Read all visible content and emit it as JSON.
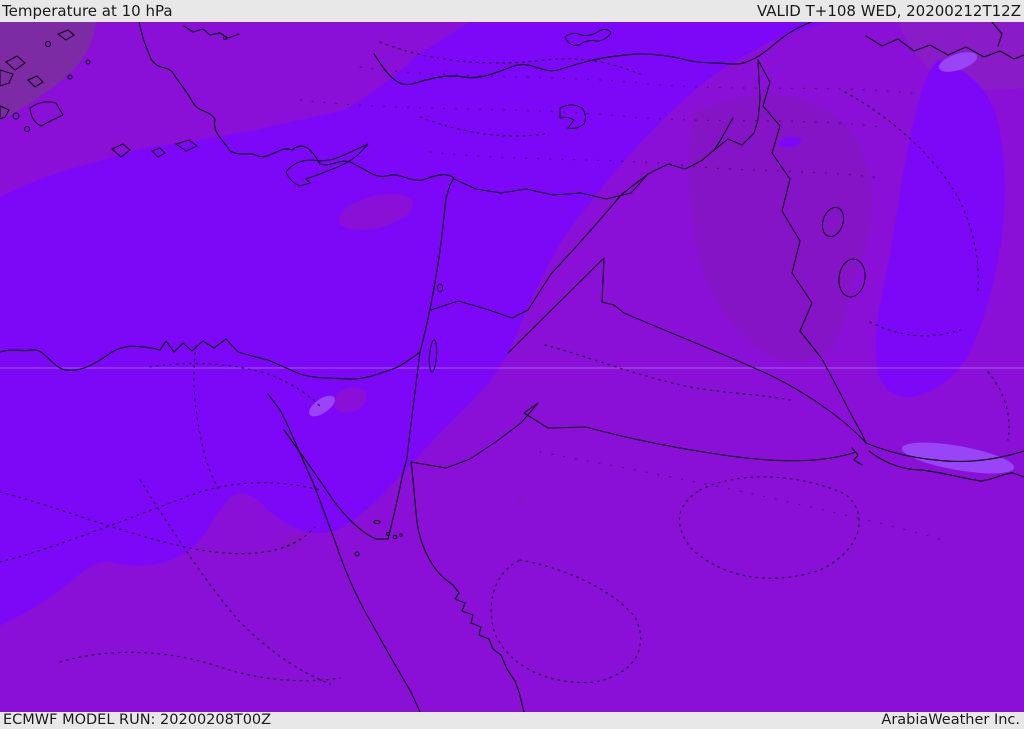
{
  "header": {
    "title": "Temperature at 10 hPa",
    "valid_label": "VALID T+108 WED, 20200212T12Z"
  },
  "footer": {
    "model_run_label": "ECMWF MODEL RUN: 20200208T00Z",
    "branding": "ArabiaWeather Inc."
  },
  "map": {
    "type": "filled-contour weather map",
    "parameter": "Temperature",
    "level": "10 hPa",
    "region": "Eastern Mediterranean / Middle East",
    "palette": {
      "base_bright": "#7d08f8",
      "medium": "#8a10d8",
      "dark": "#8414c6",
      "dull_nw": "#7d2ba4",
      "dull_ne": "#8a1bc8",
      "light": "#9a44f8",
      "line": "#0a0010",
      "contour": "#1a0524",
      "graticule": "#c9a8ff",
      "bar_bg": "#e8e8e8",
      "bar_text": "#1a1a1a"
    }
  }
}
